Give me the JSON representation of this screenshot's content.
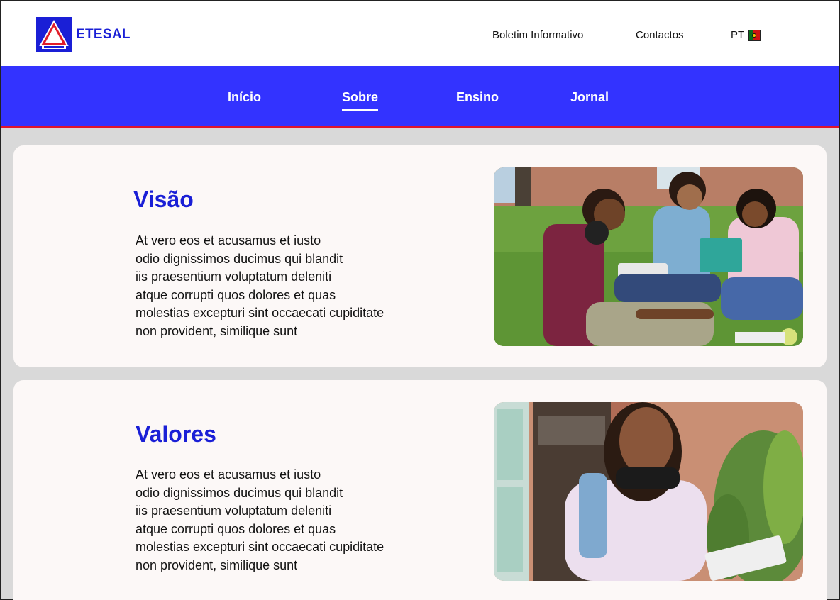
{
  "header": {
    "logo_text": "ETESAL",
    "links": {
      "newsletter": "Boletim Informativo",
      "contacts": "Contactos",
      "language": "PT"
    }
  },
  "nav": {
    "items": [
      "Início",
      "Sobre",
      "Ensino",
      "Jornal"
    ],
    "active": "Sobre"
  },
  "sections": [
    {
      "title": "Visão",
      "body": [
        "At vero eos et acusamus et iusto",
        "odio dignissimos ducimus qui blandit",
        "iis praesentium voluptatum deleniti",
        "atque corrupti quos dolores et quas",
        "molestias excepturi sint occaecati cupiditate",
        "non provident, similique sunt"
      ],
      "image": "students-studying-on-grass-photo"
    },
    {
      "title": "Valores",
      "body": [
        "At vero eos et acusamus et iusto",
        "odio dignissimos ducimus qui blandit",
        "iis praesentium voluptatum deleniti",
        "atque corrupti quos dolores et quas",
        "molestias excepturi sint occaecati cupiditate",
        "non provident, similique sunt"
      ],
      "image": "smiling-student-with-headphones-photo"
    }
  ],
  "colors": {
    "brand_blue": "#1a1fd6",
    "nav_blue": "#3333ff",
    "nav_border": "#e0142c",
    "card_bg": "#fcf8f7",
    "page_bg": "#d9d9d9"
  }
}
